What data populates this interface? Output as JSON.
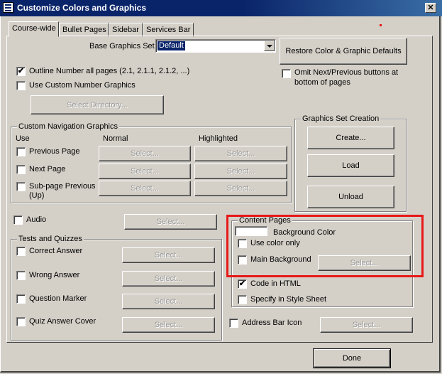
{
  "window": {
    "title": "Customize Colors and Graphics",
    "close_glyph": "✕"
  },
  "tabs": [
    "Course-wide",
    "Bullet Pages",
    "Sidebar",
    "Services Bar"
  ],
  "base_graphics": {
    "label": "Base Graphics Set",
    "value": "Default"
  },
  "restore_button": "Restore Color & Graphic Defaults",
  "outline_number": {
    "label": "Outline Number all pages (2.1, 2.1.1, 2.1.2, ...)",
    "checked": true
  },
  "omit_next_prev": {
    "label_line1": "Omit Next/Previous buttons at",
    "label_line2": "bottom of pages",
    "checked": false
  },
  "custom_number": {
    "label": "Use Custom Number Graphics",
    "checked": false
  },
  "select_directory_button": "Select Directory...",
  "nav_graphics": {
    "title": "Custom Navigation Graphics",
    "headers": {
      "use": "Use",
      "normal": "Normal",
      "highlighted": "Highlighted"
    },
    "rows": [
      {
        "label": "Previous Page",
        "normal": "Select...",
        "highlighted": "Select..."
      },
      {
        "label": "Next Page",
        "normal": "Select...",
        "highlighted": "Select..."
      },
      {
        "label_line1": "Sub-page Previous",
        "label_line2": "(Up)",
        "normal": "Select...",
        "highlighted": "Select..."
      }
    ]
  },
  "graphics_set_creation": {
    "title": "Graphics Set Creation",
    "create": "Create...",
    "load": "Load",
    "unload": "Unload"
  },
  "audio": {
    "label": "Audio",
    "button": "Select..."
  },
  "tests": {
    "title": "Tests and Quizzes",
    "rows": [
      {
        "label": "Correct Answer",
        "button": "Select..."
      },
      {
        "label": "Wrong Answer",
        "button": "Select..."
      },
      {
        "label": "Question Marker",
        "button": "Select..."
      },
      {
        "label": "Quiz Answer Cover",
        "button": "Select..."
      }
    ]
  },
  "content_pages": {
    "title": "Content Pages",
    "background_color": "Background Color",
    "use_color_only": "Use color only",
    "main_background": "Main Background",
    "main_background_button": "Select...",
    "code_in_html": "Code in HTML",
    "specify_style_sheet": "Specify in Style Sheet"
  },
  "address_bar": {
    "label": "Address Bar Icon",
    "button": "Select..."
  },
  "done_button": "Done",
  "colors": {
    "title_bar": "#0a246a",
    "face": "#d4d0c8",
    "highlight_box": "#e81818"
  }
}
